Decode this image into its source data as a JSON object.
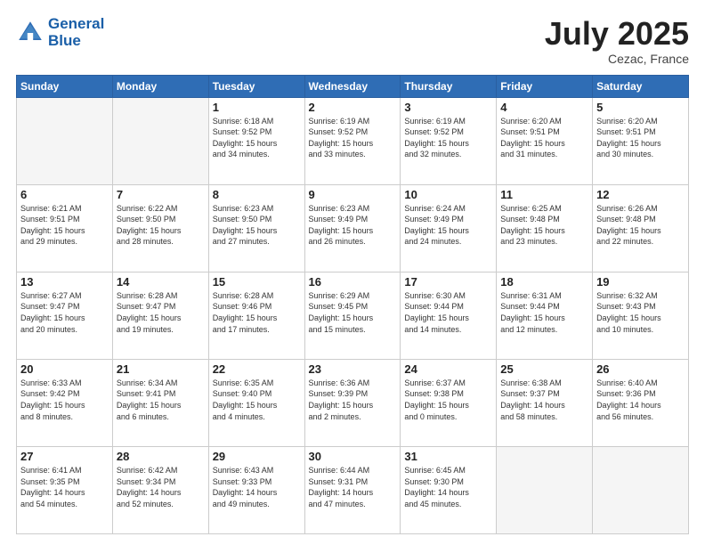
{
  "header": {
    "logo_line1": "General",
    "logo_line2": "Blue",
    "month_title": "July 2025",
    "subtitle": "Cezac, France"
  },
  "weekdays": [
    "Sunday",
    "Monday",
    "Tuesday",
    "Wednesday",
    "Thursday",
    "Friday",
    "Saturday"
  ],
  "weeks": [
    [
      {
        "day": "",
        "info": ""
      },
      {
        "day": "",
        "info": ""
      },
      {
        "day": "1",
        "info": "Sunrise: 6:18 AM\nSunset: 9:52 PM\nDaylight: 15 hours\nand 34 minutes."
      },
      {
        "day": "2",
        "info": "Sunrise: 6:19 AM\nSunset: 9:52 PM\nDaylight: 15 hours\nand 33 minutes."
      },
      {
        "day": "3",
        "info": "Sunrise: 6:19 AM\nSunset: 9:52 PM\nDaylight: 15 hours\nand 32 minutes."
      },
      {
        "day": "4",
        "info": "Sunrise: 6:20 AM\nSunset: 9:51 PM\nDaylight: 15 hours\nand 31 minutes."
      },
      {
        "day": "5",
        "info": "Sunrise: 6:20 AM\nSunset: 9:51 PM\nDaylight: 15 hours\nand 30 minutes."
      }
    ],
    [
      {
        "day": "6",
        "info": "Sunrise: 6:21 AM\nSunset: 9:51 PM\nDaylight: 15 hours\nand 29 minutes."
      },
      {
        "day": "7",
        "info": "Sunrise: 6:22 AM\nSunset: 9:50 PM\nDaylight: 15 hours\nand 28 minutes."
      },
      {
        "day": "8",
        "info": "Sunrise: 6:23 AM\nSunset: 9:50 PM\nDaylight: 15 hours\nand 27 minutes."
      },
      {
        "day": "9",
        "info": "Sunrise: 6:23 AM\nSunset: 9:49 PM\nDaylight: 15 hours\nand 26 minutes."
      },
      {
        "day": "10",
        "info": "Sunrise: 6:24 AM\nSunset: 9:49 PM\nDaylight: 15 hours\nand 24 minutes."
      },
      {
        "day": "11",
        "info": "Sunrise: 6:25 AM\nSunset: 9:48 PM\nDaylight: 15 hours\nand 23 minutes."
      },
      {
        "day": "12",
        "info": "Sunrise: 6:26 AM\nSunset: 9:48 PM\nDaylight: 15 hours\nand 22 minutes."
      }
    ],
    [
      {
        "day": "13",
        "info": "Sunrise: 6:27 AM\nSunset: 9:47 PM\nDaylight: 15 hours\nand 20 minutes."
      },
      {
        "day": "14",
        "info": "Sunrise: 6:28 AM\nSunset: 9:47 PM\nDaylight: 15 hours\nand 19 minutes."
      },
      {
        "day": "15",
        "info": "Sunrise: 6:28 AM\nSunset: 9:46 PM\nDaylight: 15 hours\nand 17 minutes."
      },
      {
        "day": "16",
        "info": "Sunrise: 6:29 AM\nSunset: 9:45 PM\nDaylight: 15 hours\nand 15 minutes."
      },
      {
        "day": "17",
        "info": "Sunrise: 6:30 AM\nSunset: 9:44 PM\nDaylight: 15 hours\nand 14 minutes."
      },
      {
        "day": "18",
        "info": "Sunrise: 6:31 AM\nSunset: 9:44 PM\nDaylight: 15 hours\nand 12 minutes."
      },
      {
        "day": "19",
        "info": "Sunrise: 6:32 AM\nSunset: 9:43 PM\nDaylight: 15 hours\nand 10 minutes."
      }
    ],
    [
      {
        "day": "20",
        "info": "Sunrise: 6:33 AM\nSunset: 9:42 PM\nDaylight: 15 hours\nand 8 minutes."
      },
      {
        "day": "21",
        "info": "Sunrise: 6:34 AM\nSunset: 9:41 PM\nDaylight: 15 hours\nand 6 minutes."
      },
      {
        "day": "22",
        "info": "Sunrise: 6:35 AM\nSunset: 9:40 PM\nDaylight: 15 hours\nand 4 minutes."
      },
      {
        "day": "23",
        "info": "Sunrise: 6:36 AM\nSunset: 9:39 PM\nDaylight: 15 hours\nand 2 minutes."
      },
      {
        "day": "24",
        "info": "Sunrise: 6:37 AM\nSunset: 9:38 PM\nDaylight: 15 hours\nand 0 minutes."
      },
      {
        "day": "25",
        "info": "Sunrise: 6:38 AM\nSunset: 9:37 PM\nDaylight: 14 hours\nand 58 minutes."
      },
      {
        "day": "26",
        "info": "Sunrise: 6:40 AM\nSunset: 9:36 PM\nDaylight: 14 hours\nand 56 minutes."
      }
    ],
    [
      {
        "day": "27",
        "info": "Sunrise: 6:41 AM\nSunset: 9:35 PM\nDaylight: 14 hours\nand 54 minutes."
      },
      {
        "day": "28",
        "info": "Sunrise: 6:42 AM\nSunset: 9:34 PM\nDaylight: 14 hours\nand 52 minutes."
      },
      {
        "day": "29",
        "info": "Sunrise: 6:43 AM\nSunset: 9:33 PM\nDaylight: 14 hours\nand 49 minutes."
      },
      {
        "day": "30",
        "info": "Sunrise: 6:44 AM\nSunset: 9:31 PM\nDaylight: 14 hours\nand 47 minutes."
      },
      {
        "day": "31",
        "info": "Sunrise: 6:45 AM\nSunset: 9:30 PM\nDaylight: 14 hours\nand 45 minutes."
      },
      {
        "day": "",
        "info": ""
      },
      {
        "day": "",
        "info": ""
      }
    ]
  ]
}
